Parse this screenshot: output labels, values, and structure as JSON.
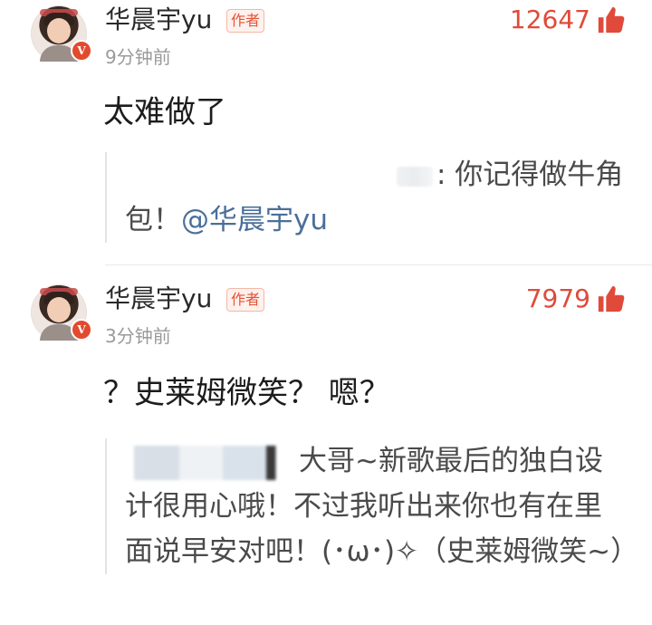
{
  "comments": [
    {
      "username": "华晨宇yu",
      "author_tag": "作者",
      "timestamp": "9分钟前",
      "likes": "12647",
      "text": "太难做了",
      "quote": {
        "text_before": ": 你记得做牛角包！",
        "mention": "@华晨宇yu"
      }
    },
    {
      "username": "华晨宇yu",
      "author_tag": "作者",
      "timestamp": "3分钟前",
      "likes": "7979",
      "text": "？史莱姆微笑？ 嗯？",
      "quote": {
        "text": "大哥~新歌最后的独白设计很用心哦！不过我听出来你也有在里面说早安对吧！(･ω･)✧（史莱姆微笑~）"
      }
    }
  ],
  "badge_letter": "V",
  "colors": {
    "like_red": "#e04a3a",
    "author_tag": "#e55233",
    "mention": "#4b6f9a",
    "timestamp": "#9a9a9a"
  },
  "icons": {
    "like": "thumbs-up-icon",
    "verified": "verified-badge-icon"
  }
}
